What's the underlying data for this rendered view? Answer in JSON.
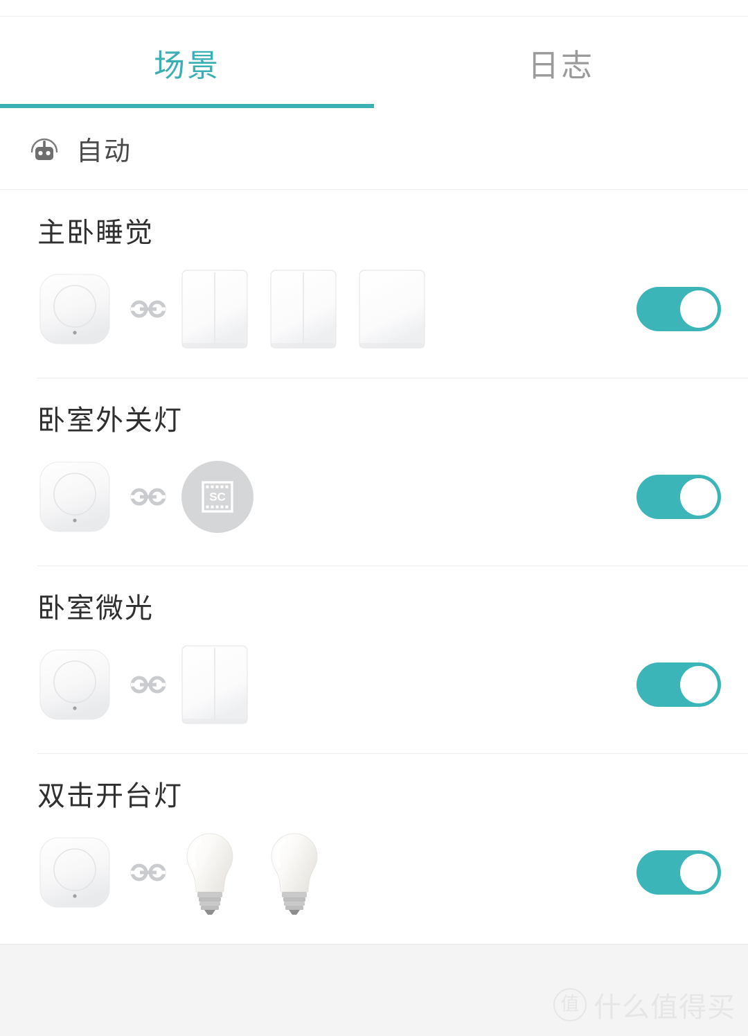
{
  "tabs": [
    {
      "label": "场景",
      "active": true,
      "name": "tab-scene"
    },
    {
      "label": "日志",
      "active": false,
      "name": "tab-log"
    }
  ],
  "section": {
    "icon": "robot-icon",
    "title": "自动"
  },
  "colors": {
    "accent": "#3AAFB4",
    "toggle_on": "#3BB5B8",
    "tab_inactive": "#9A9A9A",
    "scene_title": "#2F2F2F",
    "divider": "#ECECEC",
    "footer_bg": "#F4F4F4"
  },
  "scenes": [
    {
      "name": "主卧睡觉",
      "trigger": "wireless-button",
      "link_icon": "link-icon",
      "devices": [
        "switch-double-rocker",
        "switch-double-rocker",
        "switch-single-rocker"
      ],
      "enabled": true,
      "toggle_state": "on"
    },
    {
      "name": "卧室外关灯",
      "trigger": "wireless-button",
      "link_icon": "link-icon",
      "devices": [
        "scene-sc-icon"
      ],
      "enabled": true,
      "toggle_state": "on"
    },
    {
      "name": "卧室微光",
      "trigger": "wireless-button",
      "link_icon": "link-icon",
      "devices": [
        "switch-double-rocker"
      ],
      "enabled": true,
      "toggle_state": "on"
    },
    {
      "name": "双击开台灯",
      "trigger": "wireless-button",
      "link_icon": "link-icon",
      "devices": [
        "light-bulb",
        "light-bulb"
      ],
      "enabled": true,
      "toggle_state": "on"
    }
  ],
  "scene_icon_label": "SC",
  "watermark": {
    "badge": "值",
    "text": "什么值得买"
  }
}
